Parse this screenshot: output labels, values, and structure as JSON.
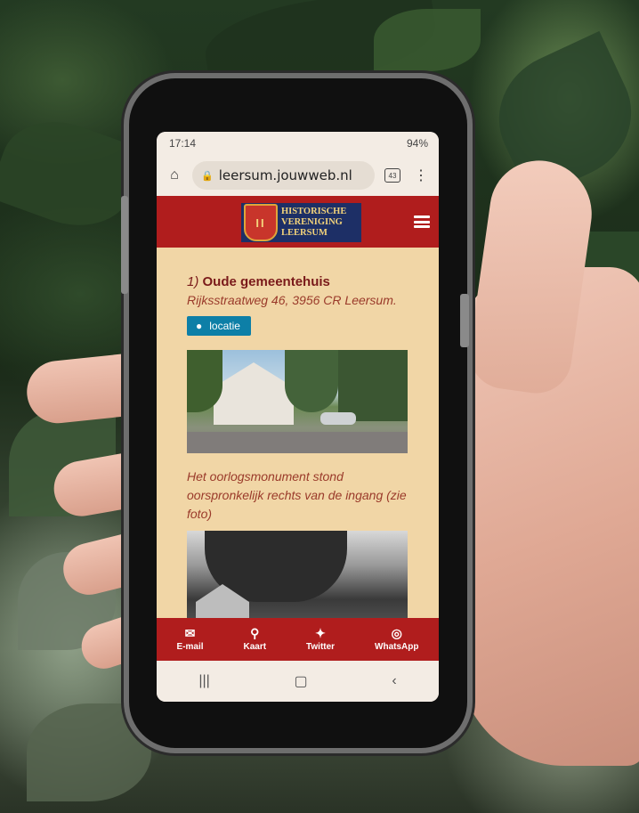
{
  "status_bar": {
    "time": "17:14",
    "battery": "94%"
  },
  "browser": {
    "url": "leersum.jouwweb.nl",
    "tab_count": "43"
  },
  "site": {
    "logo_lines": [
      "HISTORISCHE",
      "VERENIGING",
      "LEERSUM"
    ]
  },
  "article": {
    "number": "1)",
    "name": "Oude gemeentehuis",
    "address": "Rijksstraatweg 46, 3956 CR Leersum.",
    "location_button": "locatie",
    "caption": "Het oorlogsmonument stond oorspronkelijk rechts van de ingang (zie foto)"
  },
  "bottom_nav": [
    {
      "label": "E-mail",
      "icon": "envelope-icon"
    },
    {
      "label": "Kaart",
      "icon": "map-pin-icon"
    },
    {
      "label": "Twitter",
      "icon": "twitter-icon"
    },
    {
      "label": "WhatsApp",
      "icon": "whatsapp-icon"
    }
  ],
  "colors": {
    "header_red": "#b01d1d",
    "content_bg": "#f1d6a6",
    "button_blue": "#0d7fa7",
    "title_color": "#7a1a1a"
  }
}
